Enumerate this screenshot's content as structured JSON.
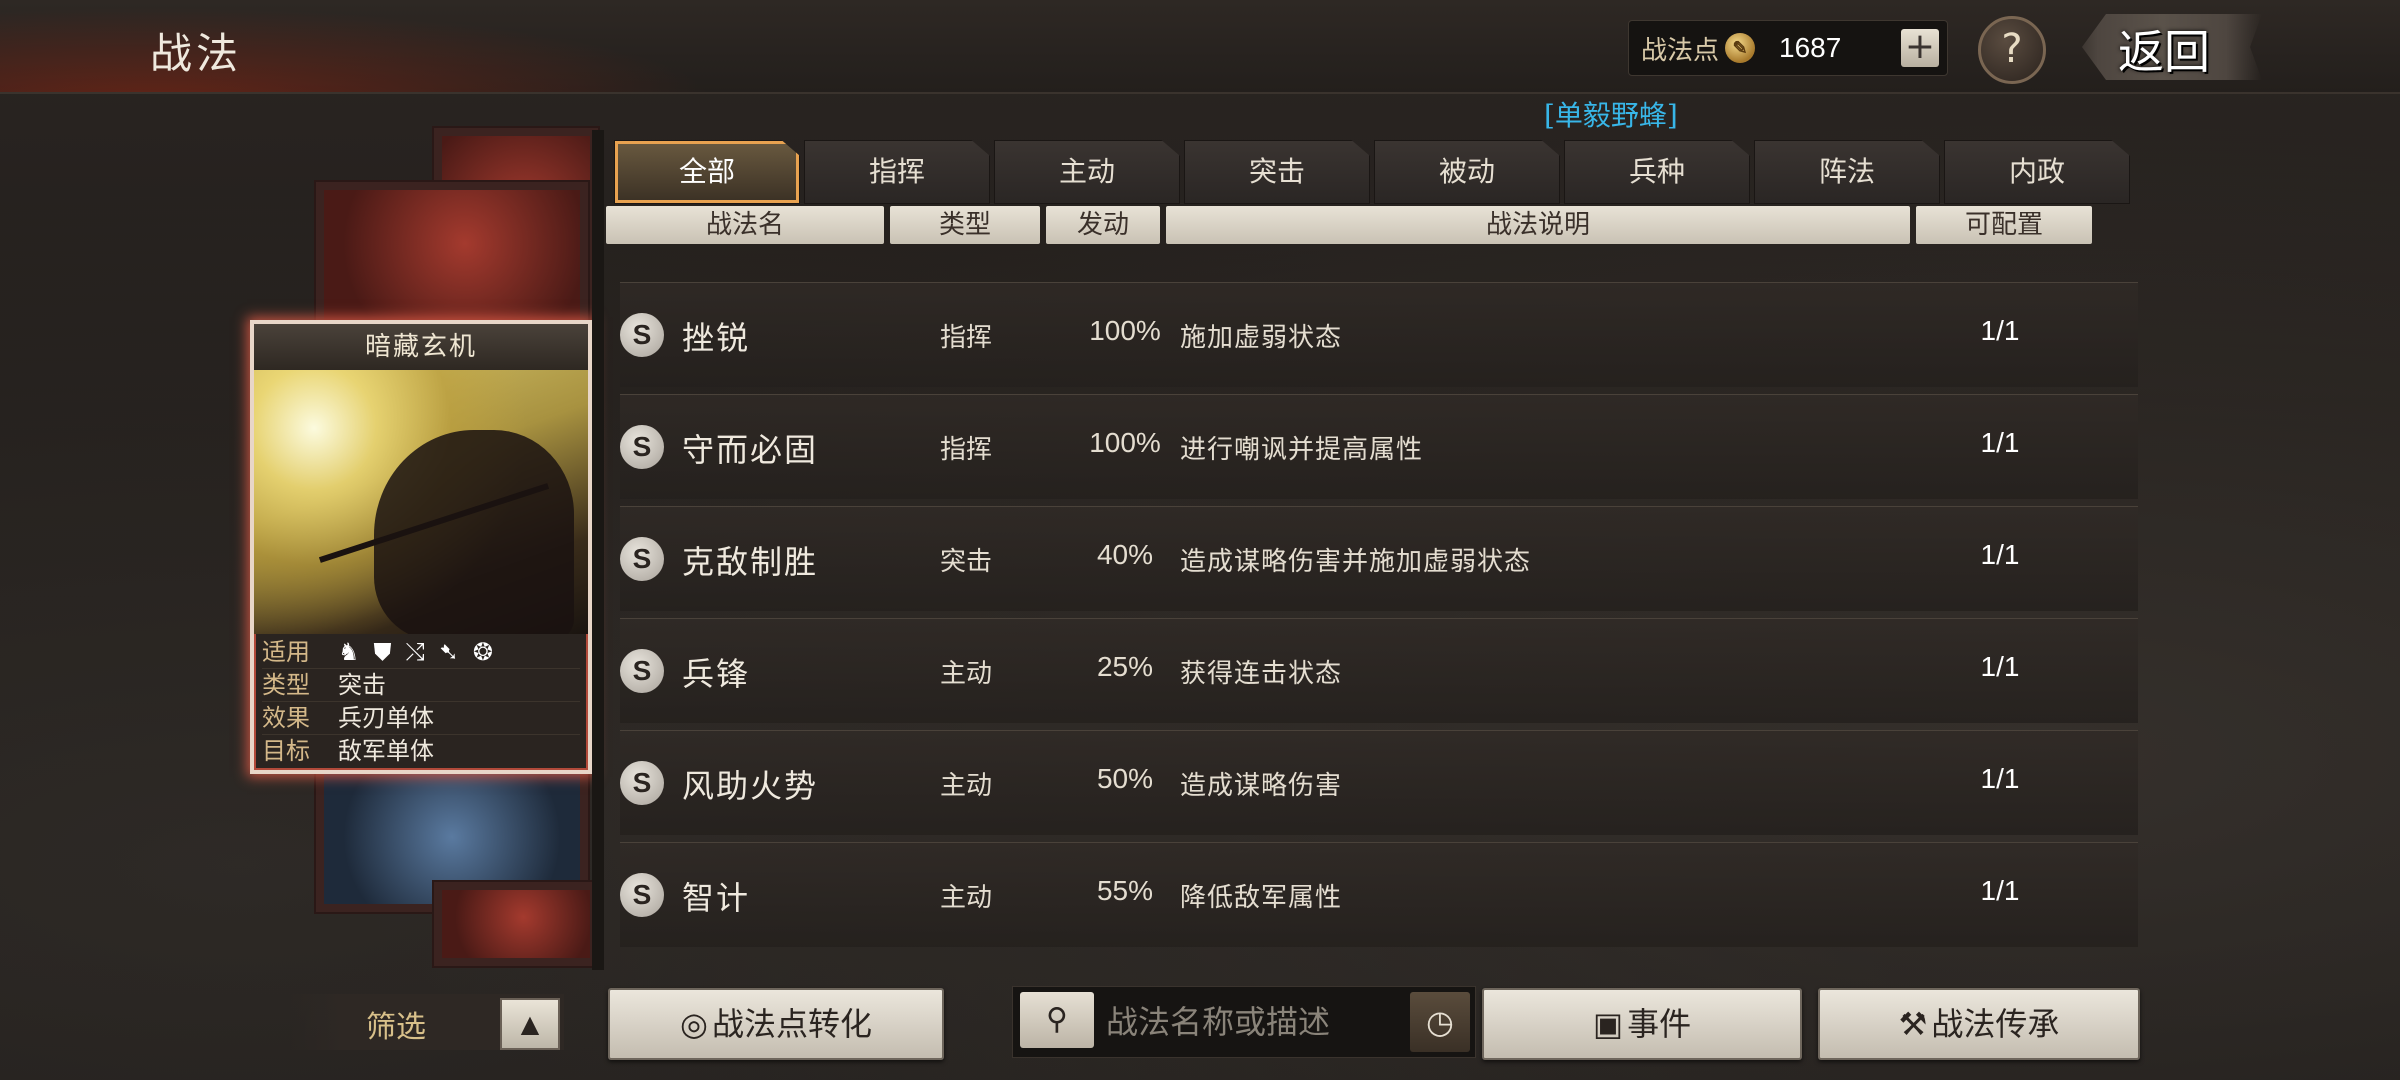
{
  "header": {
    "title": "战法",
    "points_label": "战法点",
    "points_value": "1687",
    "plus_label": "+",
    "help_label": "?",
    "back_label": "返回"
  },
  "general_name": "[单毅野蜂]",
  "card": {
    "name": "暗藏玄机",
    "attrs": [
      {
        "key": "适用",
        "value": ""
      },
      {
        "key": "类型",
        "value": "突击"
      },
      {
        "key": "效果",
        "value": "兵刃单体"
      },
      {
        "key": "目标",
        "value": "敌军单体"
      }
    ],
    "troop_icons": [
      "cavalry-icon",
      "shield-icon",
      "bow-icon",
      "spear-icon",
      "chariot-icon"
    ]
  },
  "tabs": [
    "全部",
    "指挥",
    "主动",
    "突击",
    "被动",
    "兵种",
    "阵法",
    "内政"
  ],
  "active_tab": 0,
  "columns": {
    "name": "战法名",
    "type": "类型",
    "rate": "发动",
    "desc": "战法说明",
    "cfg": "可配置"
  },
  "rows": [
    {
      "grade": "S",
      "name": "挫锐",
      "type": "指挥",
      "rate": "100%",
      "desc": "施加虚弱状态",
      "cfg": "1/1"
    },
    {
      "grade": "S",
      "name": "守而必固",
      "type": "指挥",
      "rate": "100%",
      "desc": "进行嘲讽并提高属性",
      "cfg": "1/1"
    },
    {
      "grade": "S",
      "name": "克敌制胜",
      "type": "突击",
      "rate": "40%",
      "desc": "造成谋略伤害并施加虚弱状态",
      "cfg": "1/1"
    },
    {
      "grade": "S",
      "name": "兵锋",
      "type": "主动",
      "rate": "25%",
      "desc": "获得连击状态",
      "cfg": "1/1"
    },
    {
      "grade": "S",
      "name": "风助火势",
      "type": "主动",
      "rate": "50%",
      "desc": "造成谋略伤害",
      "cfg": "1/1"
    },
    {
      "grade": "S",
      "name": "智计",
      "type": "主动",
      "rate": "55%",
      "desc": "降低敌军属性",
      "cfg": "1/1"
    }
  ],
  "bottom": {
    "filter_label": "筛选",
    "convert_label": "战法点转化",
    "search_placeholder": "战法名称或描述",
    "event_label": "事件",
    "inherit_label": "战法传承"
  },
  "colors": {
    "active_tab_border": "#e8a250",
    "card_glow": "#dc5a46",
    "general_name": "#38b6e8"
  }
}
